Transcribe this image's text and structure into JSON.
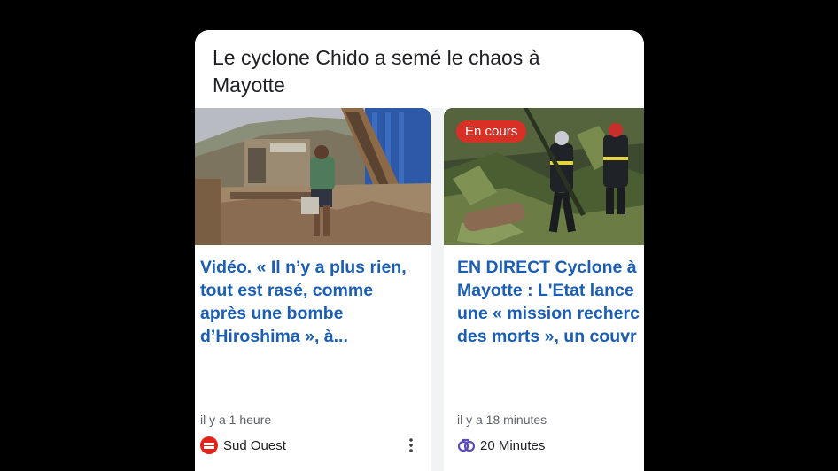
{
  "cluster": {
    "title": "Le cyclone Chido a semé le chaos à Mayotte"
  },
  "articles": [
    {
      "headline": [
        "Vidéo. « Il n’y a plus rien,",
        "tout est rasé, comme",
        "après une bombe",
        "d’Hiroshima », à..."
      ],
      "time": "il y a 1 heure",
      "source": "Sud Ouest",
      "logo_icon": "sud-ouest-logo",
      "more_icon": "more-vertical-icon"
    },
    {
      "badge": "En cours",
      "headline": [
        "EN DIRECT Cyclone à",
        "Mayotte : L'Etat lance",
        "une « mission recherc",
        "des morts », un couvr"
      ],
      "time": "il y a 18 minutes",
      "source": "20 Minutes",
      "logo_icon": "20-minutes-logo"
    }
  ],
  "colors": {
    "background": "#000000",
    "headline_link": "#1a5fb4",
    "live_badge": "#d93025"
  }
}
